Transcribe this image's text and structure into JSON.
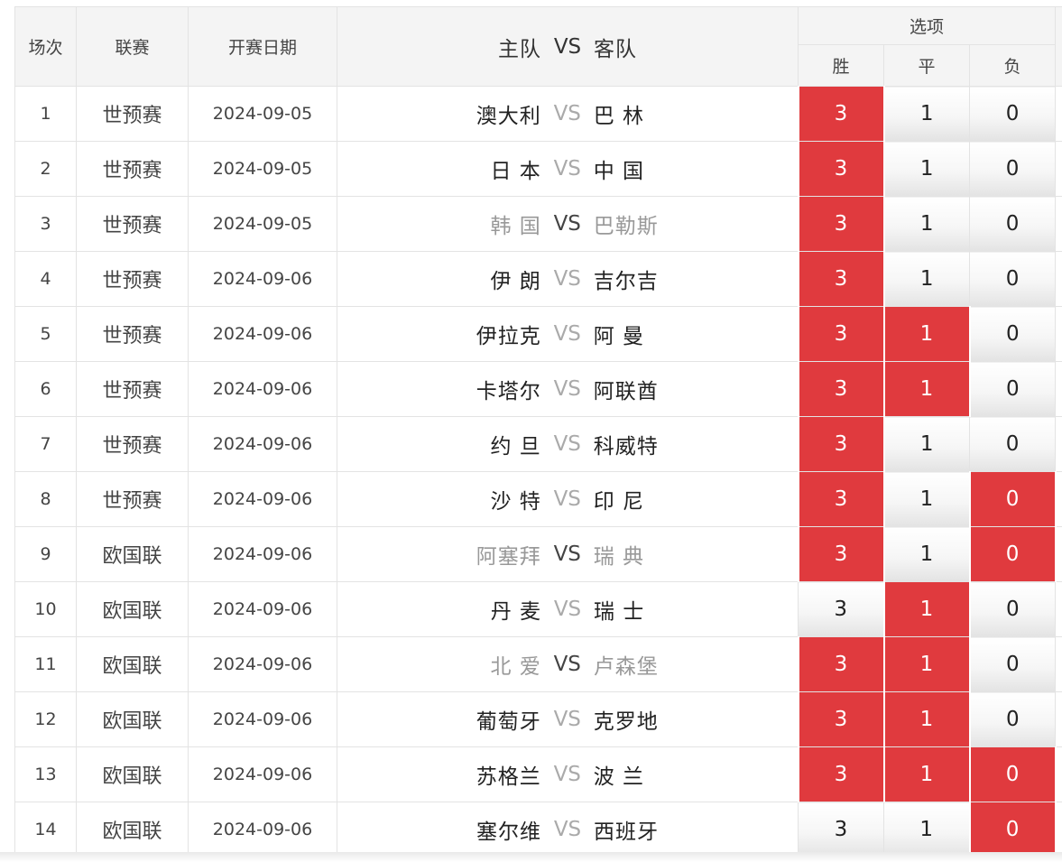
{
  "header": {
    "col_index": "场次",
    "col_league": "联赛",
    "col_date": "开赛日期",
    "col_home": "主队",
    "col_vs": "VS",
    "col_away": "客队",
    "col_options": "选项",
    "opt_win": "胜",
    "opt_draw": "平",
    "opt_lose": "负"
  },
  "colors": {
    "selected": "#e03a3e",
    "header_bg": "#f4f4f4",
    "border": "#e3e3e3"
  },
  "matches": [
    {
      "idx": "1",
      "league": "世预赛",
      "date": "2024-09-05",
      "home": "澳大利",
      "vs": "VS",
      "away": "巴 林",
      "dim": false,
      "win": "3",
      "draw": "1",
      "lose": "0",
      "sel": [
        true,
        false,
        false
      ]
    },
    {
      "idx": "2",
      "league": "世预赛",
      "date": "2024-09-05",
      "home": "日 本",
      "vs": "VS",
      "away": "中 国",
      "dim": false,
      "win": "3",
      "draw": "1",
      "lose": "0",
      "sel": [
        true,
        false,
        false
      ]
    },
    {
      "idx": "3",
      "league": "世预赛",
      "date": "2024-09-05",
      "home": "韩 国",
      "vs": "VS",
      "away": "巴勒斯",
      "dim": true,
      "win": "3",
      "draw": "1",
      "lose": "0",
      "sel": [
        true,
        false,
        false
      ]
    },
    {
      "idx": "4",
      "league": "世预赛",
      "date": "2024-09-06",
      "home": "伊 朗",
      "vs": "VS",
      "away": "吉尔吉",
      "dim": false,
      "win": "3",
      "draw": "1",
      "lose": "0",
      "sel": [
        true,
        false,
        false
      ]
    },
    {
      "idx": "5",
      "league": "世预赛",
      "date": "2024-09-06",
      "home": "伊拉克",
      "vs": "VS",
      "away": "阿 曼",
      "dim": false,
      "win": "3",
      "draw": "1",
      "lose": "0",
      "sel": [
        true,
        true,
        false
      ]
    },
    {
      "idx": "6",
      "league": "世预赛",
      "date": "2024-09-06",
      "home": "卡塔尔",
      "vs": "VS",
      "away": "阿联酋",
      "dim": false,
      "win": "3",
      "draw": "1",
      "lose": "0",
      "sel": [
        true,
        true,
        false
      ]
    },
    {
      "idx": "7",
      "league": "世预赛",
      "date": "2024-09-06",
      "home": "约 旦",
      "vs": "VS",
      "away": "科威特",
      "dim": false,
      "win": "3",
      "draw": "1",
      "lose": "0",
      "sel": [
        true,
        false,
        false
      ]
    },
    {
      "idx": "8",
      "league": "世预赛",
      "date": "2024-09-06",
      "home": "沙 特",
      "vs": "VS",
      "away": "印 尼",
      "dim": false,
      "win": "3",
      "draw": "1",
      "lose": "0",
      "sel": [
        true,
        false,
        true
      ]
    },
    {
      "idx": "9",
      "league": "欧国联",
      "date": "2024-09-06",
      "home": "阿塞拜",
      "vs": "VS",
      "away": "瑞 典",
      "dim": true,
      "win": "3",
      "draw": "1",
      "lose": "0",
      "sel": [
        true,
        false,
        true
      ]
    },
    {
      "idx": "10",
      "league": "欧国联",
      "date": "2024-09-06",
      "home": "丹 麦",
      "vs": "VS",
      "away": "瑞 士",
      "dim": false,
      "win": "3",
      "draw": "1",
      "lose": "0",
      "sel": [
        false,
        true,
        false
      ]
    },
    {
      "idx": "11",
      "league": "欧国联",
      "date": "2024-09-06",
      "home": "北 爱",
      "vs": "VS",
      "away": "卢森堡",
      "dim": true,
      "win": "3",
      "draw": "1",
      "lose": "0",
      "sel": [
        true,
        true,
        false
      ]
    },
    {
      "idx": "12",
      "league": "欧国联",
      "date": "2024-09-06",
      "home": "葡萄牙",
      "vs": "VS",
      "away": "克罗地",
      "dim": false,
      "win": "3",
      "draw": "1",
      "lose": "0",
      "sel": [
        true,
        true,
        false
      ]
    },
    {
      "idx": "13",
      "league": "欧国联",
      "date": "2024-09-06",
      "home": "苏格兰",
      "vs": "VS",
      "away": "波 兰",
      "dim": false,
      "win": "3",
      "draw": "1",
      "lose": "0",
      "sel": [
        true,
        true,
        true
      ]
    },
    {
      "idx": "14",
      "league": "欧国联",
      "date": "2024-09-06",
      "home": "塞尔维",
      "vs": "VS",
      "away": "西班牙",
      "dim": false,
      "win": "3",
      "draw": "1",
      "lose": "0",
      "sel": [
        false,
        false,
        true
      ]
    }
  ]
}
